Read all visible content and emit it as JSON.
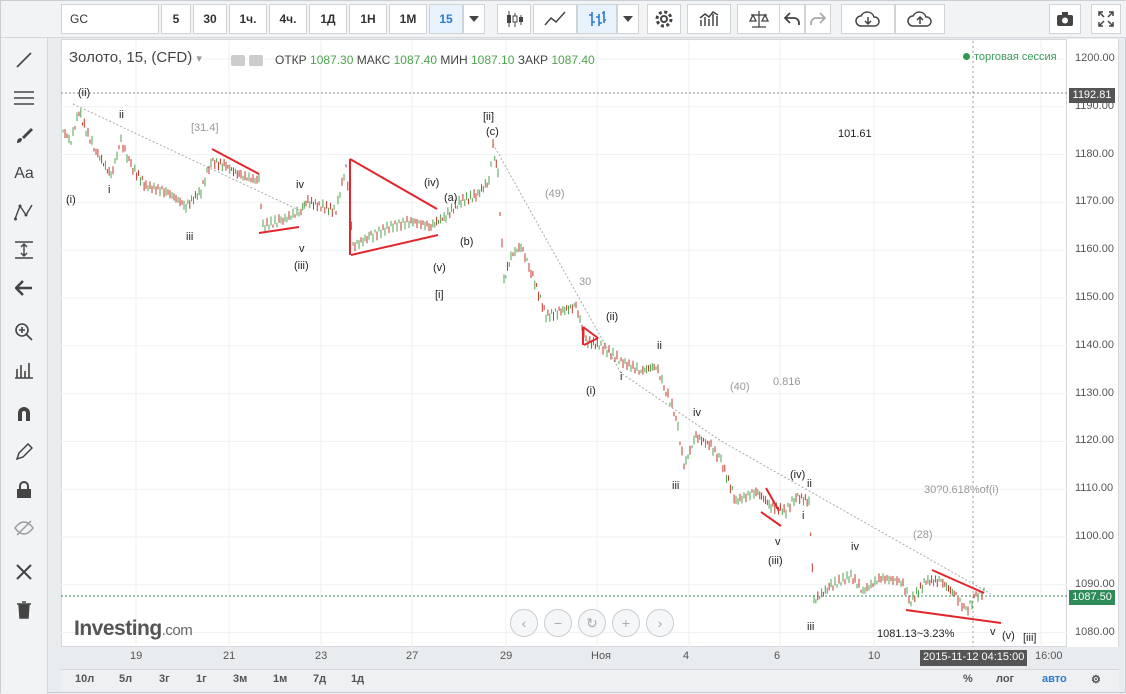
{
  "toolbar": {
    "symbol": "GC",
    "intervals": [
      "5",
      "30",
      "1ч.",
      "4ч.",
      "1Д",
      "1Н",
      "1М",
      "15"
    ],
    "active_interval": "15"
  },
  "legend": {
    "title": "Золото, 15, (CFD)",
    "open_label": "ОТКР",
    "open": "1087.30",
    "high_label": "МАКС",
    "high": "1087.40",
    "low_label": "МИН",
    "low": "1087.10",
    "close_label": "ЗАКР",
    "close": "1087.40"
  },
  "session": {
    "label": "торговая сессия"
  },
  "y_ticks": [
    "1200.00",
    "1190.00",
    "1180.00",
    "1170.00",
    "1160.00",
    "1150.00",
    "1140.00",
    "1130.00",
    "1120.00",
    "1110.00",
    "1100.00",
    "1090.00",
    "1080.00"
  ],
  "price_tags": {
    "high_line": "1192.81",
    "last": "1087.50"
  },
  "x_ticks": [
    "19",
    "21",
    "23",
    "27",
    "29",
    "Ноя",
    "4",
    "6",
    "10",
    "16:00"
  ],
  "crosshair_time": "2015-11-12 04:15:00",
  "bottom": {
    "ranges": [
      "10л",
      "5л",
      "3г",
      "1г",
      "3м",
      "1м",
      "7д",
      "1д"
    ],
    "percent": "%",
    "log": "лог",
    "auto": "авто"
  },
  "annotations": {
    "ii_a": "(ii)",
    "ii_b": "ii",
    "i_a": "(i)",
    "i_b": "i",
    "iii_a": "iii",
    "n314": "[31.4]",
    "iv_a": "iv",
    "v_a": "v",
    "iii_b": "(iii)",
    "iv_b": "(iv)",
    "a": "(a)",
    "b": "(b)",
    "v_b": "(v)",
    "i_c": "[i]",
    "ii_c": "[ii]",
    "c": "(c)",
    "n49": "(49)",
    "n30": "30",
    "ii_d": "(ii)",
    "i_d": "(i)",
    "i_e": "i",
    "ii_e": "ii",
    "n40": "(40)",
    "n0816": "0.816",
    "iv_c": "iv",
    "iii_c": "iii",
    "v_c": "v",
    "iii_d": "(iii)",
    "iv_d": "(iv)",
    "ii_f": "ii",
    "i_f": "i",
    "n10161": "101.61",
    "fib": "30?0.618%of(i)",
    "n28": "(28)",
    "iv_e": "iv",
    "iii_e": "iii",
    "ext": "1081.13~3.23%",
    "v_d": "v",
    "v_e": "(v)",
    "iii_f": "[iii]"
  },
  "watermark": {
    "brand": "Investing",
    "suffix": ".com"
  },
  "colors": {
    "up": "#4fa34f",
    "down": "#c0392b",
    "trendline": "#e3262b",
    "accent": "#2a7bd3"
  }
}
